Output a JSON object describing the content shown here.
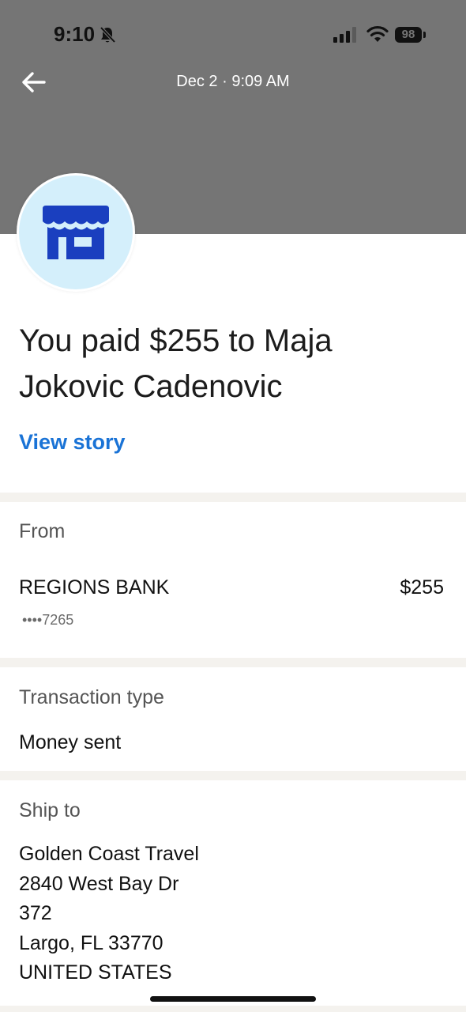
{
  "status_bar": {
    "time": "9:10",
    "battery": "98"
  },
  "header": {
    "date": "Dec 2 · 9:09 AM"
  },
  "title": "You paid $255 to Maja Jokovic Cadenovic",
  "view_story": "View story",
  "from": {
    "label": "From",
    "bank": "REGIONS BANK",
    "amount": "$255",
    "masked": "••••7265"
  },
  "transaction": {
    "label": "Transaction type",
    "value": "Money sent"
  },
  "ship_to": {
    "label": "Ship to",
    "lines": [
      "Golden Coast Travel",
      "2840 West Bay Dr",
      "372",
      "Largo, FL 33770",
      "UNITED STATES"
    ]
  },
  "colors": {
    "header_bg": "#757575",
    "avatar_bg": "#d4effb",
    "icon_blue": "#1a3fbf",
    "link_blue": "#1a73d6",
    "divider": "#f4f2ee"
  },
  "icons": {
    "back": "arrow-left-icon",
    "bell": "bell-slash-icon",
    "signal": "cellular-signal-icon",
    "wifi": "wifi-icon",
    "merchant": "storefront-icon"
  }
}
